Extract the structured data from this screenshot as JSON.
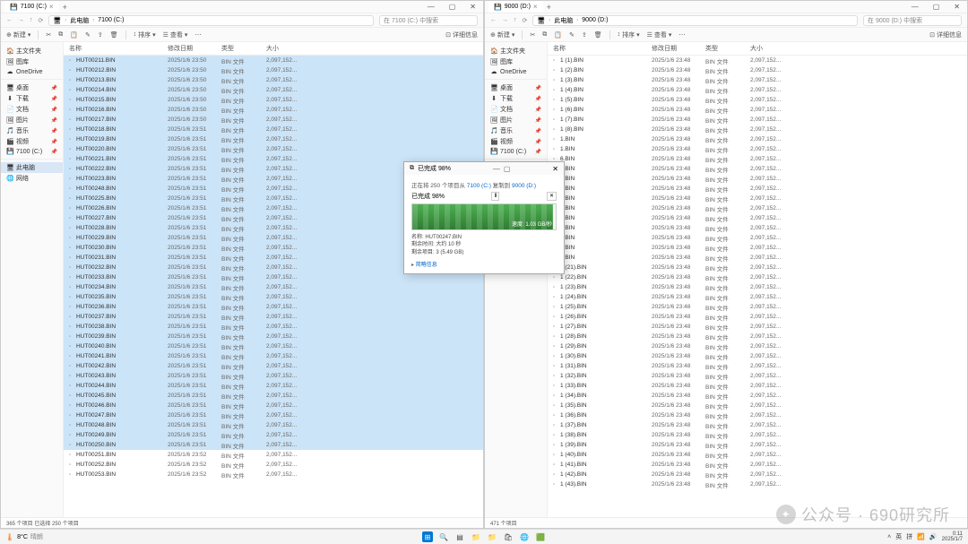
{
  "left_window": {
    "tab_title": "7100 (C:)",
    "breadcrumb": {
      "root": "此电脑",
      "folder": "7100 (C:)"
    },
    "search_placeholder": "在 7100 (C:) 中搜索",
    "status": "365 个项目   已选择 250 个项目"
  },
  "right_window": {
    "tab_title": "9000 (D:)",
    "breadcrumb": {
      "root": "此电脑",
      "folder": "9000 (D:)"
    },
    "search_placeholder": "在 9000 (D:) 中搜索",
    "status": "471 个项目"
  },
  "toolbar": {
    "new": "新建",
    "sort": "排序",
    "view": "查看",
    "details": "详细信息"
  },
  "sidebar": {
    "home": "主文件夹",
    "gallery": "图库",
    "onedrive": "OneDrive",
    "desktop": "桌面",
    "downloads": "下载",
    "documents": "文档",
    "pictures": "图片",
    "music": "音乐",
    "videos": "视频",
    "drive_c": "7100 (C:)",
    "this_pc": "此电脑",
    "network": "网络"
  },
  "columns": {
    "name": "名称",
    "date": "修改日期",
    "type": "类型",
    "size": "大小"
  },
  "left_files": [
    {
      "n": "HUT00211.BIN",
      "d": "2025/1/6 23:50",
      "t": "BIN 文件",
      "s": "2,097,152..."
    },
    {
      "n": "HUT00212.BIN",
      "d": "2025/1/6 23:50",
      "t": "BIN 文件",
      "s": "2,097,152..."
    },
    {
      "n": "HUT00213.BIN",
      "d": "2025/1/6 23:50",
      "t": "BIN 文件",
      "s": "2,097,152..."
    },
    {
      "n": "HUT00214.BIN",
      "d": "2025/1/6 23:50",
      "t": "BIN 文件",
      "s": "2,097,152..."
    },
    {
      "n": "HUT00215.BIN",
      "d": "2025/1/6 23:50",
      "t": "BIN 文件",
      "s": "2,097,152..."
    },
    {
      "n": "HUT00216.BIN",
      "d": "2025/1/6 23:50",
      "t": "BIN 文件",
      "s": "2,097,152..."
    },
    {
      "n": "HUT00217.BIN",
      "d": "2025/1/6 23:50",
      "t": "BIN 文件",
      "s": "2,097,152..."
    },
    {
      "n": "HUT00218.BIN",
      "d": "2025/1/6 23:51",
      "t": "BIN 文件",
      "s": "2,097,152..."
    },
    {
      "n": "HUT00219.BIN",
      "d": "2025/1/6 23:51",
      "t": "BIN 文件",
      "s": "2,097,152..."
    },
    {
      "n": "HUT00220.BIN",
      "d": "2025/1/6 23:51",
      "t": "BIN 文件",
      "s": "2,097,152..."
    },
    {
      "n": "HUT00221.BIN",
      "d": "2025/1/6 23:51",
      "t": "BIN 文件",
      "s": "2,097,152..."
    },
    {
      "n": "HUT00222.BIN",
      "d": "2025/1/6 23:51",
      "t": "BIN 文件",
      "s": "2,097,152..."
    },
    {
      "n": "HUT00223.BIN",
      "d": "2025/1/6 23:51",
      "t": "BIN 文件",
      "s": "2,097,152..."
    },
    {
      "n": "HUT00248.BIN",
      "d": "2025/1/6 23:51",
      "t": "BIN 文件",
      "s": "2,097,152..."
    },
    {
      "n": "HUT00225.BIN",
      "d": "2025/1/6 23:51",
      "t": "BIN 文件",
      "s": "2,097,152..."
    },
    {
      "n": "HUT00226.BIN",
      "d": "2025/1/6 23:51",
      "t": "BIN 文件",
      "s": "2,097,152..."
    },
    {
      "n": "HUT00227.BIN",
      "d": "2025/1/6 23:51",
      "t": "BIN 文件",
      "s": "2,097,152..."
    },
    {
      "n": "HUT00228.BIN",
      "d": "2025/1/6 23:51",
      "t": "BIN 文件",
      "s": "2,097,152..."
    },
    {
      "n": "HUT00229.BIN",
      "d": "2025/1/6 23:51",
      "t": "BIN 文件",
      "s": "2,097,152..."
    },
    {
      "n": "HUT00230.BIN",
      "d": "2025/1/6 23:51",
      "t": "BIN 文件",
      "s": "2,097,152..."
    },
    {
      "n": "HUT00231.BIN",
      "d": "2025/1/6 23:51",
      "t": "BIN 文件",
      "s": "2,097,152..."
    },
    {
      "n": "HUT00232.BIN",
      "d": "2025/1/6 23:51",
      "t": "BIN 文件",
      "s": "2,097,152..."
    },
    {
      "n": "HUT00233.BIN",
      "d": "2025/1/6 23:51",
      "t": "BIN 文件",
      "s": "2,097,152..."
    },
    {
      "n": "HUT00234.BIN",
      "d": "2025/1/6 23:51",
      "t": "BIN 文件",
      "s": "2,097,152..."
    },
    {
      "n": "HUT00235.BIN",
      "d": "2025/1/6 23:51",
      "t": "BIN 文件",
      "s": "2,097,152..."
    },
    {
      "n": "HUT00236.BIN",
      "d": "2025/1/6 23:51",
      "t": "BIN 文件",
      "s": "2,097,152..."
    },
    {
      "n": "HUT00237.BIN",
      "d": "2025/1/6 23:51",
      "t": "BIN 文件",
      "s": "2,097,152..."
    },
    {
      "n": "HUT00238.BIN",
      "d": "2025/1/6 23:51",
      "t": "BIN 文件",
      "s": "2,097,152..."
    },
    {
      "n": "HUT00239.BIN",
      "d": "2025/1/6 23:51",
      "t": "BIN 文件",
      "s": "2,097,152..."
    },
    {
      "n": "HUT00240.BIN",
      "d": "2025/1/6 23:51",
      "t": "BIN 文件",
      "s": "2,097,152..."
    },
    {
      "n": "HUT00241.BIN",
      "d": "2025/1/6 23:51",
      "t": "BIN 文件",
      "s": "2,097,152..."
    },
    {
      "n": "HUT00242.BIN",
      "d": "2025/1/6 23:51",
      "t": "BIN 文件",
      "s": "2,097,152..."
    },
    {
      "n": "HUT00243.BIN",
      "d": "2025/1/6 23:51",
      "t": "BIN 文件",
      "s": "2,097,152..."
    },
    {
      "n": "HUT00244.BIN",
      "d": "2025/1/6 23:51",
      "t": "BIN 文件",
      "s": "2,097,152..."
    },
    {
      "n": "HUT00245.BIN",
      "d": "2025/1/6 23:51",
      "t": "BIN 文件",
      "s": "2,097,152..."
    },
    {
      "n": "HUT00246.BIN",
      "d": "2025/1/6 23:51",
      "t": "BIN 文件",
      "s": "2,097,152..."
    },
    {
      "n": "HUT00247.BIN",
      "d": "2025/1/6 23:51",
      "t": "BIN 文件",
      "s": "2,097,152..."
    },
    {
      "n": "HUT00248.BIN",
      "d": "2025/1/6 23:51",
      "t": "BIN 文件",
      "s": "2,097,152..."
    },
    {
      "n": "HUT00249.BIN",
      "d": "2025/1/6 23:51",
      "t": "BIN 文件",
      "s": "2,097,152..."
    },
    {
      "n": "HUT00250.BIN",
      "d": "2025/1/6 23:51",
      "t": "BIN 文件",
      "s": "2,097,152..."
    },
    {
      "n": "HUT00251.BIN",
      "d": "2025/1/6 23:52",
      "t": "BIN 文件",
      "s": "2,097,152..."
    },
    {
      "n": "HUT00252.BIN",
      "d": "2025/1/6 23:52",
      "t": "BIN 文件",
      "s": "2,097,152..."
    },
    {
      "n": "HUT00253.BIN",
      "d": "2025/1/6 23:52",
      "t": "BIN 文件",
      "s": "2,097,152..."
    }
  ],
  "right_files": [
    {
      "n": "1 (1).BIN",
      "d": "2025/1/6 23:48",
      "t": "BIN 文件",
      "s": "2,097,152..."
    },
    {
      "n": "1 (2).BIN",
      "d": "2025/1/6 23:48",
      "t": "BIN 文件",
      "s": "2,097,152..."
    },
    {
      "n": "1 (3).BIN",
      "d": "2025/1/6 23:48",
      "t": "BIN 文件",
      "s": "2,097,152..."
    },
    {
      "n": "1 (4).BIN",
      "d": "2025/1/6 23:48",
      "t": "BIN 文件",
      "s": "2,097,152..."
    },
    {
      "n": "1 (5).BIN",
      "d": "2025/1/6 23:48",
      "t": "BIN 文件",
      "s": "2,097,152..."
    },
    {
      "n": "1 (6).BIN",
      "d": "2025/1/6 23:48",
      "t": "BIN 文件",
      "s": "2,097,152..."
    },
    {
      "n": "1 (7).BIN",
      "d": "2025/1/6 23:48",
      "t": "BIN 文件",
      "s": "2,097,152..."
    },
    {
      "n": "1 (8).BIN",
      "d": "2025/1/6 23:48",
      "t": "BIN 文件",
      "s": "2,097,152..."
    },
    {
      "n": "1.BIN",
      "d": "2025/1/6 23:48",
      "t": "BIN 文件",
      "s": "2,097,152..."
    },
    {
      "n": "1.BIN",
      "d": "2025/1/6 23:48",
      "t": "BIN 文件",
      "s": "2,097,152..."
    },
    {
      "n": "6.BIN",
      "d": "2025/1/6 23:48",
      "t": "BIN 文件",
      "s": "2,097,152..."
    },
    {
      "n": "6.BIN",
      "d": "2025/1/6 23:48",
      "t": "BIN 文件",
      "s": "2,097,152..."
    },
    {
      "n": "6.BIN",
      "d": "2025/1/6 23:48",
      "t": "BIN 文件",
      "s": "2,097,152..."
    },
    {
      "n": "6.BIN",
      "d": "2025/1/6 23:48",
      "t": "BIN 文件",
      "s": "2,097,152..."
    },
    {
      "n": "6.BIN",
      "d": "2025/1/6 23:48",
      "t": "BIN 文件",
      "s": "2,097,152..."
    },
    {
      "n": "6.BIN",
      "d": "2025/1/6 23:48",
      "t": "BIN 文件",
      "s": "2,097,152..."
    },
    {
      "n": "6.BIN",
      "d": "2025/1/6 23:48",
      "t": "BIN 文件",
      "s": "2,097,152..."
    },
    {
      "n": "6.BIN",
      "d": "2025/1/6 23:48",
      "t": "BIN 文件",
      "s": "2,097,152..."
    },
    {
      "n": "6.BIN",
      "d": "2025/1/6 23:48",
      "t": "BIN 文件",
      "s": "2,097,152..."
    },
    {
      "n": "6.BIN",
      "d": "2025/1/6 23:48",
      "t": "BIN 文件",
      "s": "2,097,152..."
    },
    {
      "n": "6.BIN",
      "d": "2025/1/6 23:48",
      "t": "BIN 文件",
      "s": "2,097,152..."
    },
    {
      "n": "1 (21).BIN",
      "d": "2025/1/6 23:48",
      "t": "BIN 文件",
      "s": "2,097,152..."
    },
    {
      "n": "1 (22).BIN",
      "d": "2025/1/6 23:48",
      "t": "BIN 文件",
      "s": "2,097,152..."
    },
    {
      "n": "1 (23).BIN",
      "d": "2025/1/6 23:48",
      "t": "BIN 文件",
      "s": "2,097,152..."
    },
    {
      "n": "1 (24).BIN",
      "d": "2025/1/6 23:48",
      "t": "BIN 文件",
      "s": "2,097,152..."
    },
    {
      "n": "1 (25).BIN",
      "d": "2025/1/6 23:48",
      "t": "BIN 文件",
      "s": "2,097,152..."
    },
    {
      "n": "1 (26).BIN",
      "d": "2025/1/6 23:48",
      "t": "BIN 文件",
      "s": "2,097,152..."
    },
    {
      "n": "1 (27).BIN",
      "d": "2025/1/6 23:48",
      "t": "BIN 文件",
      "s": "2,097,152..."
    },
    {
      "n": "1 (28).BIN",
      "d": "2025/1/6 23:48",
      "t": "BIN 文件",
      "s": "2,097,152..."
    },
    {
      "n": "1 (29).BIN",
      "d": "2025/1/6 23:48",
      "t": "BIN 文件",
      "s": "2,097,152..."
    },
    {
      "n": "1 (30).BIN",
      "d": "2025/1/6 23:48",
      "t": "BIN 文件",
      "s": "2,097,152..."
    },
    {
      "n": "1 (31).BIN",
      "d": "2025/1/6 23:48",
      "t": "BIN 文件",
      "s": "2,097,152..."
    },
    {
      "n": "1 (32).BIN",
      "d": "2025/1/6 23:48",
      "t": "BIN 文件",
      "s": "2,097,152..."
    },
    {
      "n": "1 (33).BIN",
      "d": "2025/1/6 23:48",
      "t": "BIN 文件",
      "s": "2,097,152..."
    },
    {
      "n": "1 (34).BIN",
      "d": "2025/1/6 23:48",
      "t": "BIN 文件",
      "s": "2,097,152..."
    },
    {
      "n": "1 (35).BIN",
      "d": "2025/1/6 23:48",
      "t": "BIN 文件",
      "s": "2,097,152..."
    },
    {
      "n": "1 (36).BIN",
      "d": "2025/1/6 23:48",
      "t": "BIN 文件",
      "s": "2,097,152..."
    },
    {
      "n": "1 (37).BIN",
      "d": "2025/1/6 23:48",
      "t": "BIN 文件",
      "s": "2,097,152..."
    },
    {
      "n": "1 (38).BIN",
      "d": "2025/1/6 23:48",
      "t": "BIN 文件",
      "s": "2,097,152..."
    },
    {
      "n": "1 (39).BIN",
      "d": "2025/1/6 23:48",
      "t": "BIN 文件",
      "s": "2,097,152..."
    },
    {
      "n": "1 (40).BIN",
      "d": "2025/1/6 23:48",
      "t": "BIN 文件",
      "s": "2,097,152..."
    },
    {
      "n": "1 (41).BIN",
      "d": "2025/1/6 23:48",
      "t": "BIN 文件",
      "s": "2,097,152..."
    },
    {
      "n": "1 (42).BIN",
      "d": "2025/1/6 23:48",
      "t": "BIN 文件",
      "s": "2,097,152..."
    },
    {
      "n": "1 (43).BIN",
      "d": "2025/1/6 23:48",
      "t": "BIN 文件",
      "s": "2,097,152..."
    }
  ],
  "dialog": {
    "title": "已完成 98%",
    "desc_prefix": "正在将 250 个项目从 ",
    "desc_src": "7100 (C:)",
    "desc_mid": " 复制到 ",
    "desc_dst": "9000 (D:)",
    "percent_label": "已完成 98%",
    "speed": "速度: 1.03 GB/秒",
    "name_label": "名称: HUT00247.BIN",
    "time_label": "剩余时间: 大约 10 秒",
    "remain_label": "剩余项目: 3 (5.49 GB)",
    "more": "简略信息"
  },
  "taskbar": {
    "temp": "8°C",
    "temp_label": "晴朗",
    "time": "0:11",
    "date": "2025/1/7",
    "ime1": "英",
    "ime2": "拼"
  },
  "watermark": "公众号 · 690研究所"
}
